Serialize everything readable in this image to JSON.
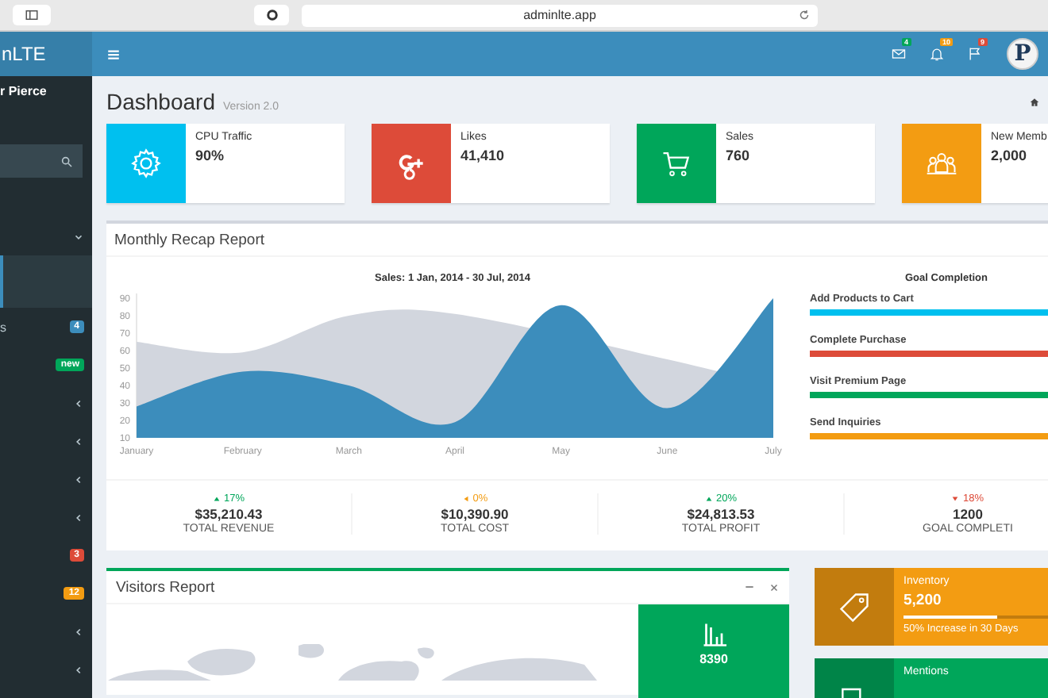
{
  "browser": {
    "address": "adminlte.app"
  },
  "sidebar": {
    "logo": "nLTE",
    "user_name": "r Pierce",
    "items": [
      {
        "kind": "tree",
        "expanded": true,
        "selected": false
      },
      {
        "kind": "block",
        "selected": true
      },
      {
        "kind": "badge",
        "label": "s",
        "badge": "4",
        "color": "#3c8dbc",
        "selected": false
      },
      {
        "kind": "badge",
        "badge": "new",
        "color": "#00a65a",
        "selected": false
      },
      {
        "kind": "tree",
        "expanded": false,
        "selected": false
      },
      {
        "kind": "tree",
        "expanded": false,
        "selected": false
      },
      {
        "kind": "tree",
        "expanded": false,
        "selected": false
      },
      {
        "kind": "tree",
        "expanded": false,
        "selected": false
      },
      {
        "kind": "badge",
        "badge": "3",
        "color": "#dd4b39",
        "selected": false
      },
      {
        "kind": "badge",
        "badge": "12",
        "color": "#f39c12",
        "selected": false
      },
      {
        "kind": "tree",
        "expanded": false,
        "selected": false
      },
      {
        "kind": "tree",
        "expanded": false,
        "selected": false
      }
    ]
  },
  "header": {
    "notifications": [
      {
        "kind": "mail",
        "badge": "4",
        "color": "#00a65a"
      },
      {
        "kind": "bell",
        "badge": "10",
        "color": "#f39c12"
      },
      {
        "kind": "flag",
        "badge": "9",
        "color": "#dd4b39"
      }
    ],
    "avatar_letter": "P"
  },
  "page": {
    "title": "Dashboard",
    "subtitle": "Version 2.0"
  },
  "info_boxes": [
    {
      "kind": "gear",
      "label": "CPU Traffic",
      "value": "90%",
      "color": "#00c0ef"
    },
    {
      "kind": "gplus",
      "label": "Likes",
      "value": "41,410",
      "color": "#dd4b39"
    },
    {
      "kind": "cart",
      "label": "Sales",
      "value": "760",
      "color": "#00a65a"
    },
    {
      "kind": "people",
      "label": "New Memb",
      "value": "2,000",
      "color": "#f39c12"
    }
  ],
  "recap": {
    "title": "Monthly Recap Report",
    "chart_title": "Sales: 1 Jan, 2014 - 30 Jul, 2014",
    "chart_data": {
      "type": "area",
      "categories": [
        "January",
        "February",
        "March",
        "April",
        "May",
        "June",
        "July"
      ],
      "series": [
        {
          "color": "#d2d6de",
          "values": [
            65,
            59,
            80,
            81,
            null,
            55,
            40
          ]
        },
        {
          "color": "#3c8dbc",
          "values": [
            28,
            48,
            40,
            19,
            86,
            27,
            90
          ]
        }
      ],
      "ylim": [
        10,
        90
      ],
      "yticks": [
        10,
        20,
        30,
        40,
        50,
        60,
        70,
        80,
        90
      ]
    },
    "goals_title": "Goal Completion",
    "goals": [
      {
        "label": "Add Products to Cart",
        "color": "#00c0ef",
        "level": 1
      },
      {
        "label": "Complete Purchase",
        "color": "#dd4b39",
        "level": 1
      },
      {
        "label": "Visit Premium Page",
        "color": "#00a65a",
        "level": 1
      },
      {
        "label": "Send Inquiries",
        "color": "#f39c12",
        "level": 1
      }
    ],
    "stats": [
      {
        "kind": "up",
        "change": "17%",
        "value": "$35,210.43",
        "label": "TOTAL REVENUE"
      },
      {
        "kind": "flat",
        "change": "0%",
        "value": "$10,390.90",
        "label": "TOTAL COST"
      },
      {
        "kind": "up",
        "change": "20%",
        "value": "$24,813.53",
        "label": "TOTAL PROFIT"
      },
      {
        "kind": "down",
        "change": "18%",
        "value": "1200",
        "label": "GOAL COMPLETI"
      }
    ]
  },
  "visitors": {
    "title": "Visitors Report",
    "visits": "8390"
  },
  "side_boxes": [
    {
      "kind": "tag",
      "label": "Inventory",
      "value": "5,200",
      "level": 0.5,
      "description": "50% Increase in 30 Days",
      "color": "#f39c12"
    },
    {
      "kind": "comments",
      "label": "Mentions",
      "color": "#00a65a"
    }
  ]
}
